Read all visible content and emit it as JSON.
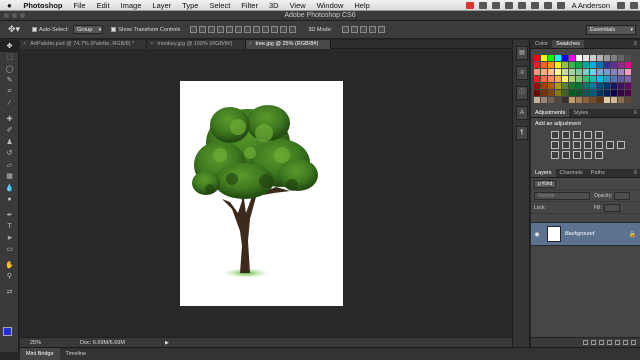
{
  "menubar": {
    "apple": "",
    "app_name": "Photoshop",
    "items": [
      "File",
      "Edit",
      "Image",
      "Layer",
      "Type",
      "Select",
      "Filter",
      "3D",
      "View",
      "Window",
      "Help"
    ],
    "user": "A Anderson"
  },
  "window": {
    "title": "Adobe Photoshop CS6"
  },
  "options": {
    "auto_select_label": "Auto-Select:",
    "auto_select_value": "Group",
    "transform_label": "Show Transform Controls",
    "mode_3d": "3D Mode:",
    "workspace": "Essentials"
  },
  "tabs": [
    {
      "label": "ArtPalette.psd @ 74.7% (Palette, RGB/8) *",
      "close": "×"
    },
    {
      "label": "monkey.jpg @ 100% (RGB/8#)",
      "close": "×"
    },
    {
      "label": "tree.jpg @ 25% (RGB/8#)",
      "close": "×"
    }
  ],
  "status": {
    "zoom": "25%",
    "doc": "Doc: 6.69M/6.69M",
    "arrow": "▶"
  },
  "bottom_tabs": [
    "Mini Bridge",
    "Timeline"
  ],
  "color_panel": {
    "tabs": [
      "Color",
      "Swatches"
    ]
  },
  "adjustments": {
    "tabs": [
      "Adjustments",
      "Styles"
    ],
    "label": "Add an adjustment"
  },
  "layers": {
    "tabs": [
      "Layers",
      "Channels",
      "Paths"
    ],
    "kind": "ρ Kind",
    "blend": "Normal",
    "opacity_label": "Opacity:",
    "lock_label": "Lock:",
    "fill_label": "Fill:",
    "layer_name": "Background"
  },
  "colors": {
    "foreground": "#1f2fd8",
    "background": "#ffffff",
    "selected_layer": "#5c7291"
  }
}
